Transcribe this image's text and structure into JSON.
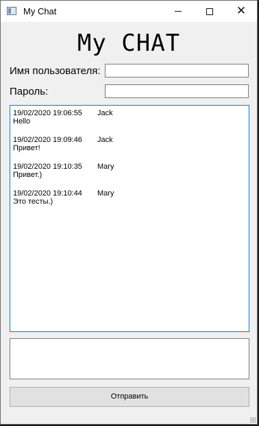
{
  "window": {
    "title": "My Chat",
    "icon": "app-window-icon"
  },
  "heading": "My CHAT",
  "form": {
    "username_label": "Имя пользователя:",
    "username_value": "",
    "password_label": "Пароль:",
    "password_value": ""
  },
  "messages": [
    {
      "time": "19/02/2020 19:06:55",
      "user": "Jack",
      "text": "Hello"
    },
    {
      "time": "19/02/2020 19:09:46",
      "user": "Jack",
      "text": "Привет!"
    },
    {
      "time": "19/02/2020 19:10:35",
      "user": "Mary",
      "text": "Привет.)"
    },
    {
      "time": "19/02/2020 19:10:44",
      "user": "Mary",
      "text": "Это тесты.)"
    }
  ],
  "compose": {
    "value": ""
  },
  "send_button": {
    "label": "Отправить"
  },
  "colors": {
    "accent": "#0b7ac9",
    "window_bg": "#f0f0f0",
    "button_bg": "#e1e1e1"
  }
}
